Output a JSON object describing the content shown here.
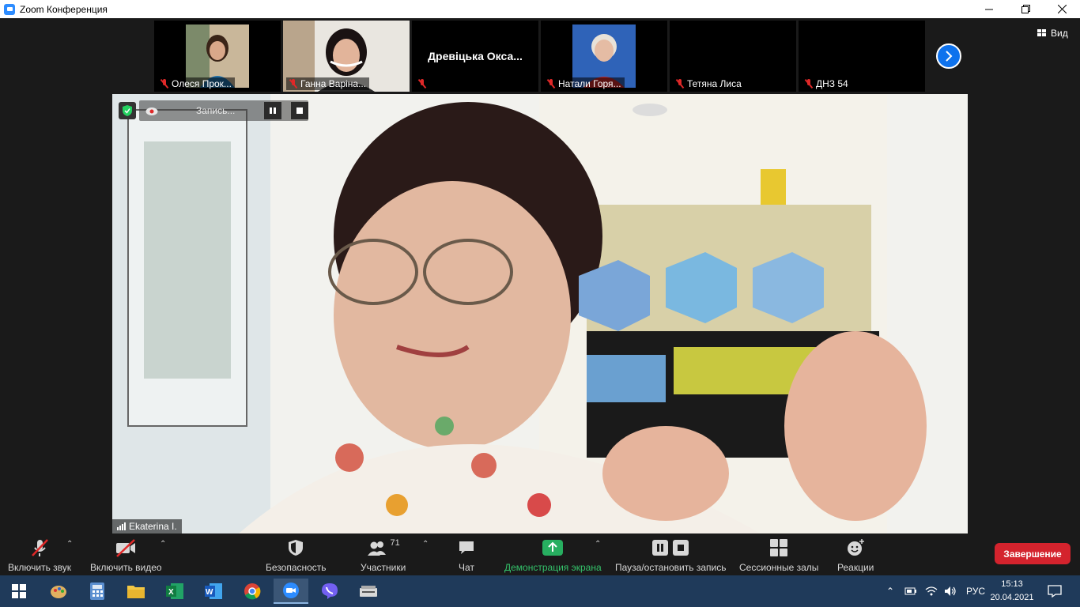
{
  "window": {
    "title": "Zoom Конференция"
  },
  "participants": [
    {
      "name": "Олеся Прок..."
    },
    {
      "name": "Ганна Варіна..."
    },
    {
      "name": "",
      "display_name": "Древіцька  Окса..."
    },
    {
      "name": "Натали Горя..."
    },
    {
      "name": "Тетяна Лиса"
    },
    {
      "name": "ДНЗ 54"
    }
  ],
  "view": {
    "label": "Вид"
  },
  "recording": {
    "label": "Запись..."
  },
  "active_speaker": {
    "name": "Ekaterina I."
  },
  "toolbar": {
    "unmute": "Включить звук",
    "start_video": "Включить видео",
    "security": "Безопасность",
    "participants": "Участники",
    "participants_count": "71",
    "chat": "Чат",
    "share_screen": "Демонстрация экрана",
    "pause_stop_recording": "Пауза/остановить запись",
    "breakout_rooms": "Сессионные залы",
    "reactions": "Реакции",
    "end": "Завершение"
  },
  "taskbar": {
    "language": "РУС",
    "time": "15:13",
    "date": "20.04.2021"
  },
  "colors": {
    "share_green": "#27ae60",
    "end_red": "#d4232d",
    "accent_blue": "#0e72ed"
  }
}
